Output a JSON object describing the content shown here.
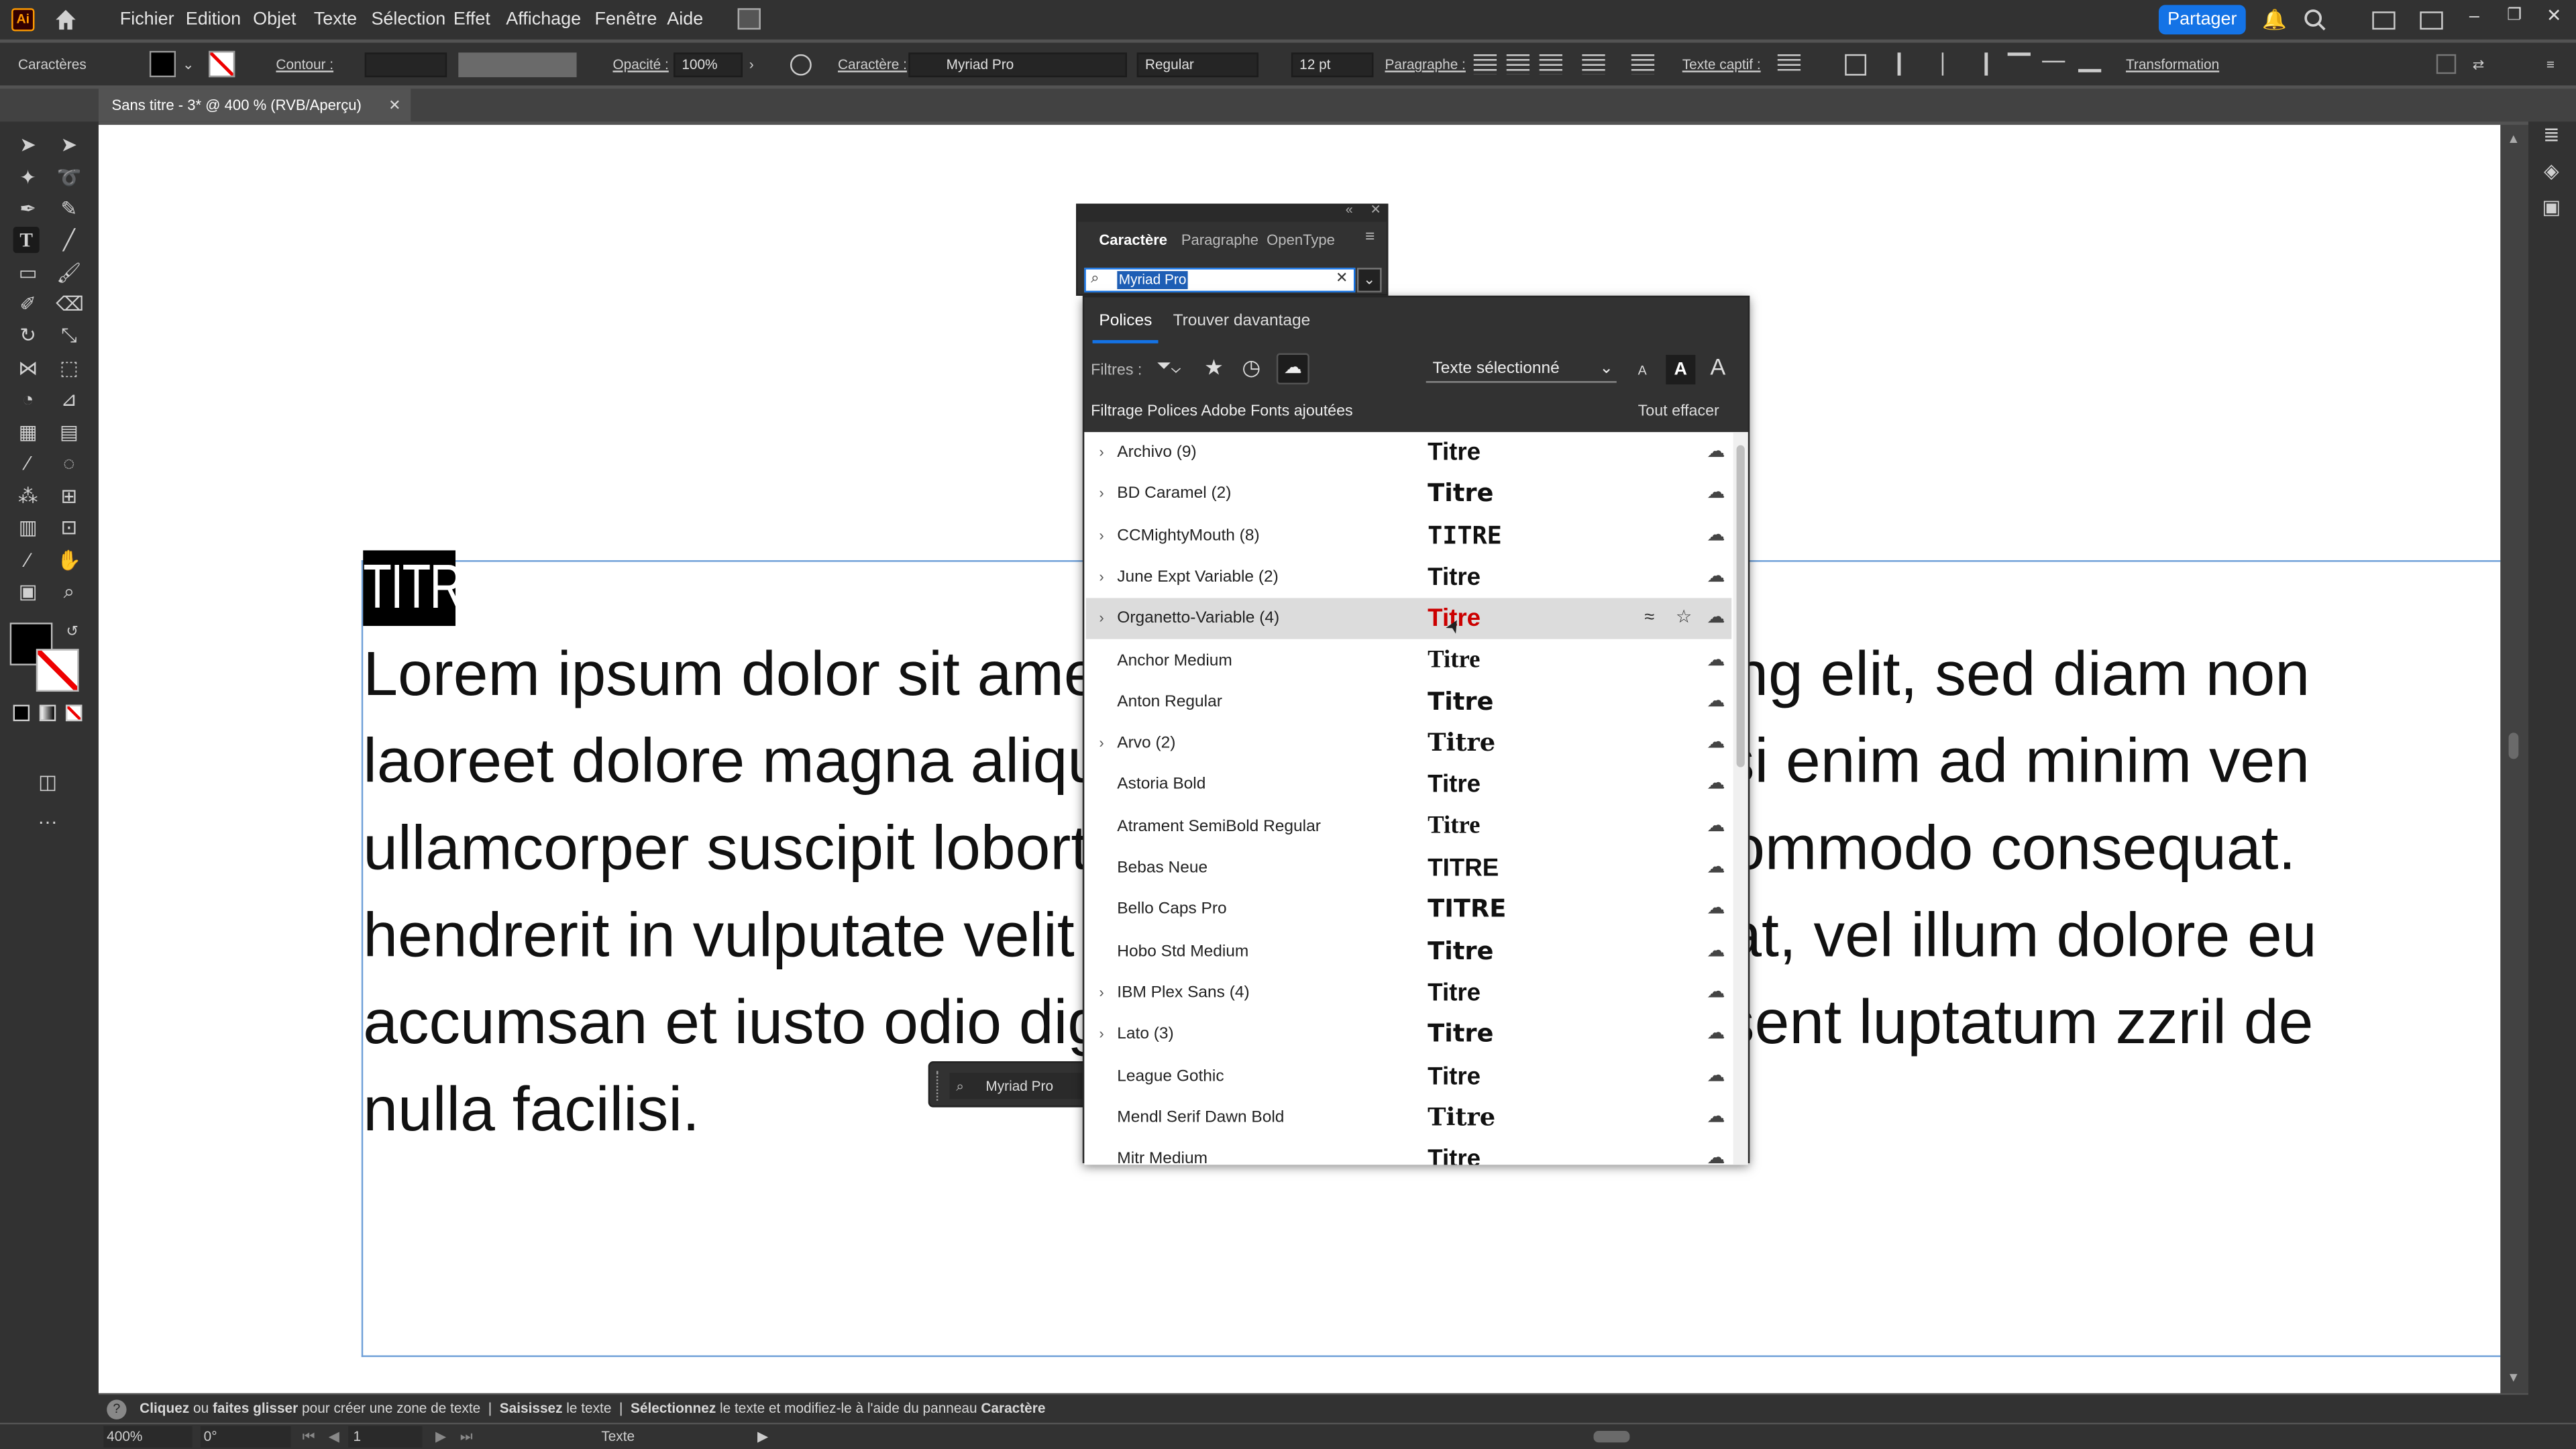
{
  "app": {
    "logo": "Ai"
  },
  "menu": [
    "Fichier",
    "Edition",
    "Objet",
    "Texte",
    "Sélection",
    "Effet",
    "Affichage",
    "Fenêtre",
    "Aide"
  ],
  "share_label": "Partager",
  "control_bar": {
    "section": "Caractères",
    "stroke_label": "Contour :",
    "opacity_label": "Opacité :",
    "opacity_value": "100%",
    "char_label": "Caractère :",
    "font_value": "Myriad Pro",
    "style_value": "Regular",
    "size_value": "12 pt",
    "paragraph_label": "Paragraphe :",
    "caption_label": "Texte captif :",
    "transform_label": "Transformation"
  },
  "document_tab": "Sans titre - 3* @ 400 % (RVB/Aperçu)",
  "canvas": {
    "title_text": "TITRE",
    "lorem_lines": [
      "Lorem ipsum dolor sit amet, consectetuer adipiscing elit, sed diam non",
      "laoreet dolore magna aliquam erat volutpat. Ut wisi enim ad minim ven",
      "ullamcorper suscipit lobortis nisl ut aliquip ex ea commodo consequat.",
      "hendrerit in vulputate velit esse molestie consequat, vel illum dolore eu",
      "accumsan et iusto odio dignissim qui blandit praesent luptatum zzril de",
      "nulla facilisi."
    ],
    "floating_font": "Myriad Pro"
  },
  "char_panel": {
    "tabs": [
      "Caractère",
      "Paragraphe",
      "OpenType"
    ],
    "search_value": "Myriad Pro"
  },
  "font_dropdown": {
    "tabs": [
      "Polices",
      "Trouver davantage"
    ],
    "filters_label": "Filtres :",
    "preview_mode": "Texte sélectionné",
    "filter_status": "Filtrage Polices Adobe Fonts ajoutées",
    "clear_all": "Tout effacer",
    "preview_word": "Titre",
    "fonts": [
      {
        "name": "Archivo (9)",
        "expand": true
      },
      {
        "name": "BD Caramel (2)",
        "expand": true
      },
      {
        "name": "CCMightyMouth (8)",
        "expand": true
      },
      {
        "name": "June Expt Variable (2)",
        "expand": true
      },
      {
        "name": "Organetto-Variable (4)",
        "expand": true,
        "hovered": true
      },
      {
        "name": "Anchor Medium",
        "expand": false
      },
      {
        "name": "Anton Regular",
        "expand": false
      },
      {
        "name": "Arvo (2)",
        "expand": true
      },
      {
        "name": "Astoria Bold",
        "expand": false
      },
      {
        "name": "Atrament SemiBold Regular",
        "expand": false
      },
      {
        "name": "Bebas Neue",
        "expand": false
      },
      {
        "name": "Bello Caps Pro",
        "expand": false
      },
      {
        "name": "Hobo Std Medium",
        "expand": false
      },
      {
        "name": "IBM Plex Sans (4)",
        "expand": true
      },
      {
        "name": "Lato (3)",
        "expand": true
      },
      {
        "name": "League Gothic",
        "expand": false
      },
      {
        "name": "Mendl Serif Dawn Bold",
        "expand": false
      },
      {
        "name": "Mitr Medium",
        "expand": false
      }
    ],
    "previews": [
      "Titre",
      "Titre",
      "TITRE",
      "Titre",
      "Titre",
      "Titre",
      "Titre",
      "Titre",
      "Titre",
      "Titre",
      "TITRE",
      "TITRE",
      "Titre",
      "Titre",
      "Titre",
      "Titre",
      "Titre",
      "Titre"
    ]
  },
  "status_bar": {
    "part1_bold": "Cliquez",
    "part1": " ou ",
    "part2_bold": "faites glisser",
    "part2": " pour créer une zone de texte",
    "part3_bold": "Saisissez",
    "part3": " le texte",
    "part4_bold": "Sélectionnez",
    "part4": " le texte et modifiez-le à l'aide du panneau ",
    "part5_bold": "Caractère"
  },
  "bottom_bar": {
    "zoom": "400%",
    "rotation": "0°",
    "artboard": "1",
    "tool": "Texte"
  },
  "colors": {
    "accent": "#1473e6",
    "ui_dark": "#323232",
    "selection": "#1e5eb5"
  }
}
